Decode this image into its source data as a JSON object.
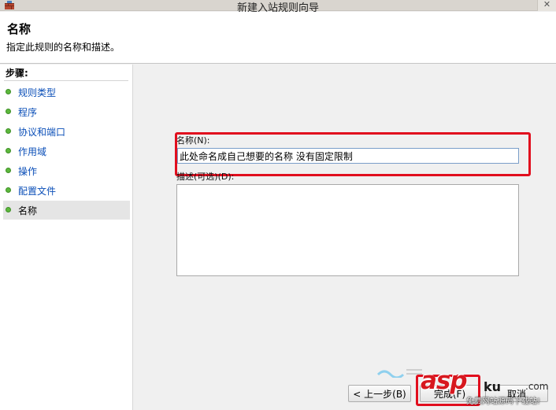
{
  "window": {
    "title": "新建入站规则向导",
    "close_glyph": "✕"
  },
  "header": {
    "title": "名称",
    "subtitle": "指定此规则的名称和描述。"
  },
  "steps": {
    "label": "步骤:",
    "items": [
      {
        "label": "规则类型",
        "active": false
      },
      {
        "label": "程序",
        "active": false
      },
      {
        "label": "协议和端口",
        "active": false
      },
      {
        "label": "作用域",
        "active": false
      },
      {
        "label": "操作",
        "active": false
      },
      {
        "label": "配置文件",
        "active": false
      },
      {
        "label": "名称",
        "active": true
      }
    ]
  },
  "form": {
    "name_label": "名称(N):",
    "name_value": "此处命名成自己想要的名称 没有固定限制",
    "desc_label": "描述(可选)(D):",
    "desc_value": ""
  },
  "buttons": {
    "back": "< 上一步(B)",
    "finish": "完成(F)",
    "cancel": "取消"
  },
  "watermark": {
    "brand": "asp",
    "cn": "ku",
    "com": ".com",
    "slogan": "免费网站源码下载站!"
  },
  "colors": {
    "highlight": "#e10e1e",
    "step_link": "#0b4fb8",
    "step_dot": "#5cb83c"
  }
}
